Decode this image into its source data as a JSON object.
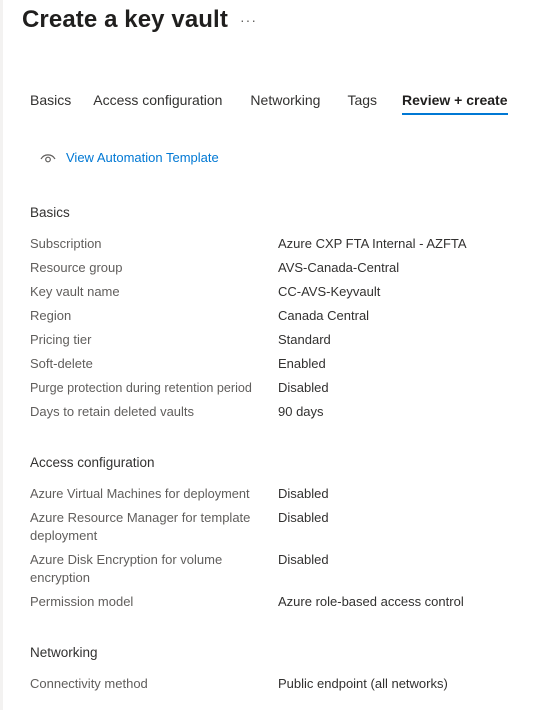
{
  "header": {
    "title": "Create a key vault",
    "more": "···"
  },
  "tabs": [
    {
      "label": "Basics",
      "active": false
    },
    {
      "label": "Access configuration",
      "active": false
    },
    {
      "label": "Networking",
      "active": false
    },
    {
      "label": "Tags",
      "active": false
    },
    {
      "label": "Review + create",
      "active": true
    }
  ],
  "automation": {
    "icon": "eye-icon",
    "label": "View Automation Template"
  },
  "sections": [
    {
      "title": "Basics",
      "rows": [
        {
          "label": "Subscription",
          "value": "Azure CXP FTA Internal - AZFTA"
        },
        {
          "label": "Resource group",
          "value": "AVS-Canada-Central"
        },
        {
          "label": "Key vault name",
          "value": "CC-AVS-Keyvault"
        },
        {
          "label": "Region",
          "value": "Canada Central"
        },
        {
          "label": "Pricing tier",
          "value": "Standard"
        },
        {
          "label": "Soft-delete",
          "value": "Enabled"
        },
        {
          "label": "Purge protection during retention period",
          "value": "Disabled"
        },
        {
          "label": "Days to retain deleted vaults",
          "value": "90 days"
        }
      ]
    },
    {
      "title": "Access configuration",
      "rows": [
        {
          "label": "Azure Virtual Machines for deployment",
          "value": "Disabled"
        },
        {
          "label": "Azure Resource Manager for template deployment",
          "value": "Disabled"
        },
        {
          "label": "Azure Disk Encryption for volume encryption",
          "value": "Disabled"
        },
        {
          "label": "Permission model",
          "value": "Azure role-based access control"
        }
      ]
    },
    {
      "title": "Networking",
      "rows": [
        {
          "label": "Connectivity method",
          "value": "Public endpoint (all networks)"
        }
      ]
    }
  ],
  "colors": {
    "accent": "#0078d4",
    "text": "#323130",
    "muted": "#605e5c"
  }
}
